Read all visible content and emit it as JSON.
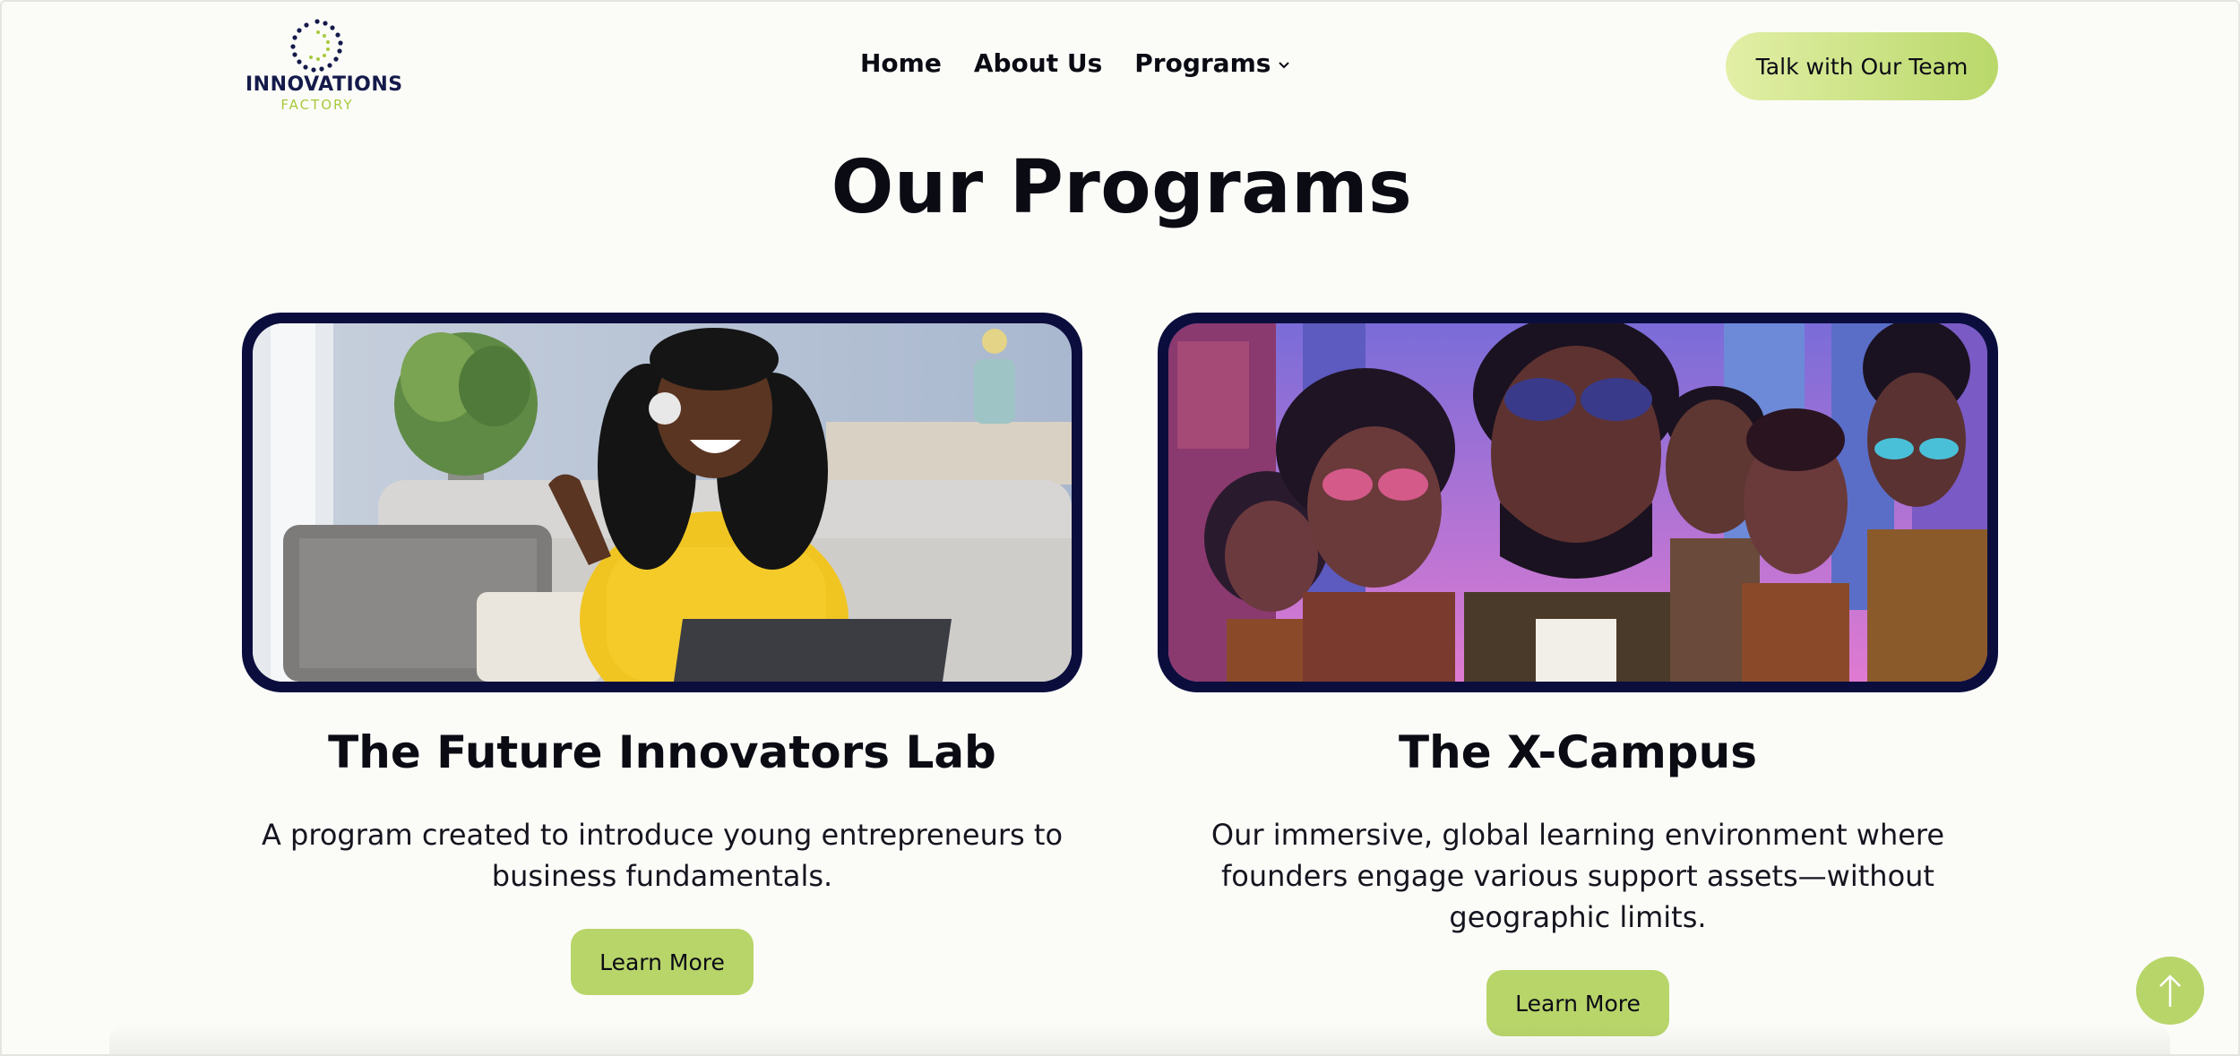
{
  "brand": {
    "name": "INNOVATIONS",
    "sub": "FACTORY",
    "colors": {
      "navy": "#141a4a",
      "lime": "#b8d56a",
      "lime_light": "#e2efa6"
    }
  },
  "nav": {
    "items": [
      {
        "label": "Home"
      },
      {
        "label": "About Us"
      },
      {
        "label": "Programs",
        "icon": "chevron-down-icon"
      }
    ],
    "cta_label": "Talk with Our Team"
  },
  "section": {
    "title": "Our Programs"
  },
  "programs": [
    {
      "title": "The Future Innovators Lab",
      "description": "A program created to introduce young entrepreneurs to business fundamentals.",
      "button_label": "Learn More",
      "image": "smiling-woman-headset-laptop"
    },
    {
      "title": "The X-Campus",
      "description": "Our immersive, global learning environment where founders engage various support assets—without geographic limits.",
      "button_label": "Learn More",
      "image": "illustrated-group-city"
    }
  ],
  "scroll_top_icon": "arrow-up-icon"
}
